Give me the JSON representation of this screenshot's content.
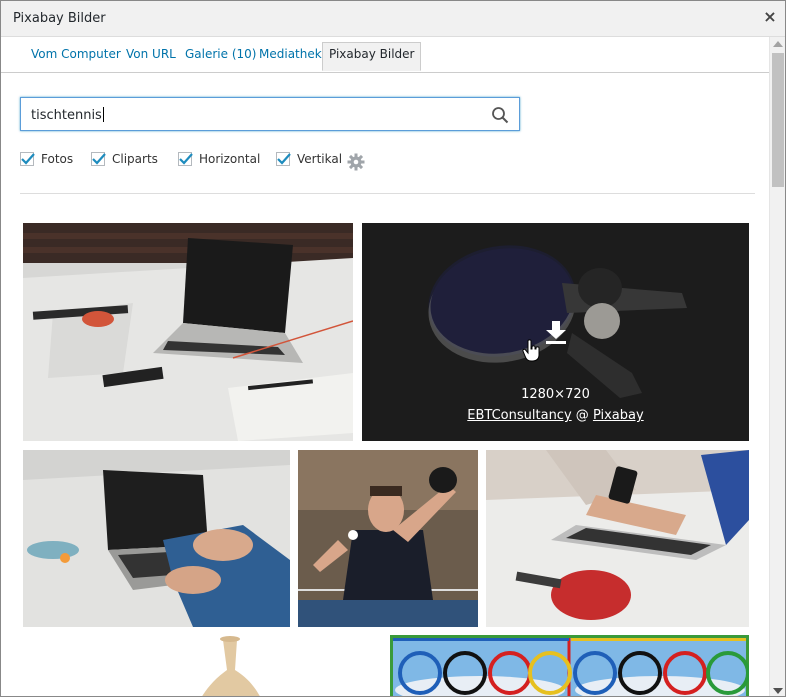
{
  "dialog": {
    "title": "Pixabay Bilder",
    "close_label": "×"
  },
  "tabs": [
    {
      "label": "Vom Computer"
    },
    {
      "label": "Von URL"
    },
    {
      "label": "Galerie (10)"
    },
    {
      "label": "Mediathek"
    },
    {
      "label": "Pixabay Bilder",
      "active": true
    }
  ],
  "search": {
    "value": "tischtennis",
    "icon": "search-icon"
  },
  "filters": [
    {
      "label": "Fotos",
      "checked": true
    },
    {
      "label": "Cliparts",
      "checked": true
    },
    {
      "label": "Horizontal",
      "checked": true
    },
    {
      "label": "Vertikal",
      "checked": true
    }
  ],
  "settings": {
    "icon": "gear-icon"
  },
  "hover_info": {
    "dimensions": "1280×720",
    "author": "EBTConsultancy",
    "separator": "@",
    "source": "Pixabay",
    "icon": "download-icon"
  },
  "results": [
    {
      "subject": "laptop with table tennis paddle on white table"
    },
    {
      "subject": "table tennis paddles on dark background"
    },
    {
      "subject": "hands typing on laptop with paddle"
    },
    {
      "subject": "table tennis player serving"
    },
    {
      "subject": "person using phone by laptop with red paddle"
    },
    {
      "subject": "wooden paddle handle"
    },
    {
      "subject": "olympic rings"
    }
  ],
  "colors": {
    "accent": "#0073aa",
    "focus": "#5b9dd9"
  }
}
